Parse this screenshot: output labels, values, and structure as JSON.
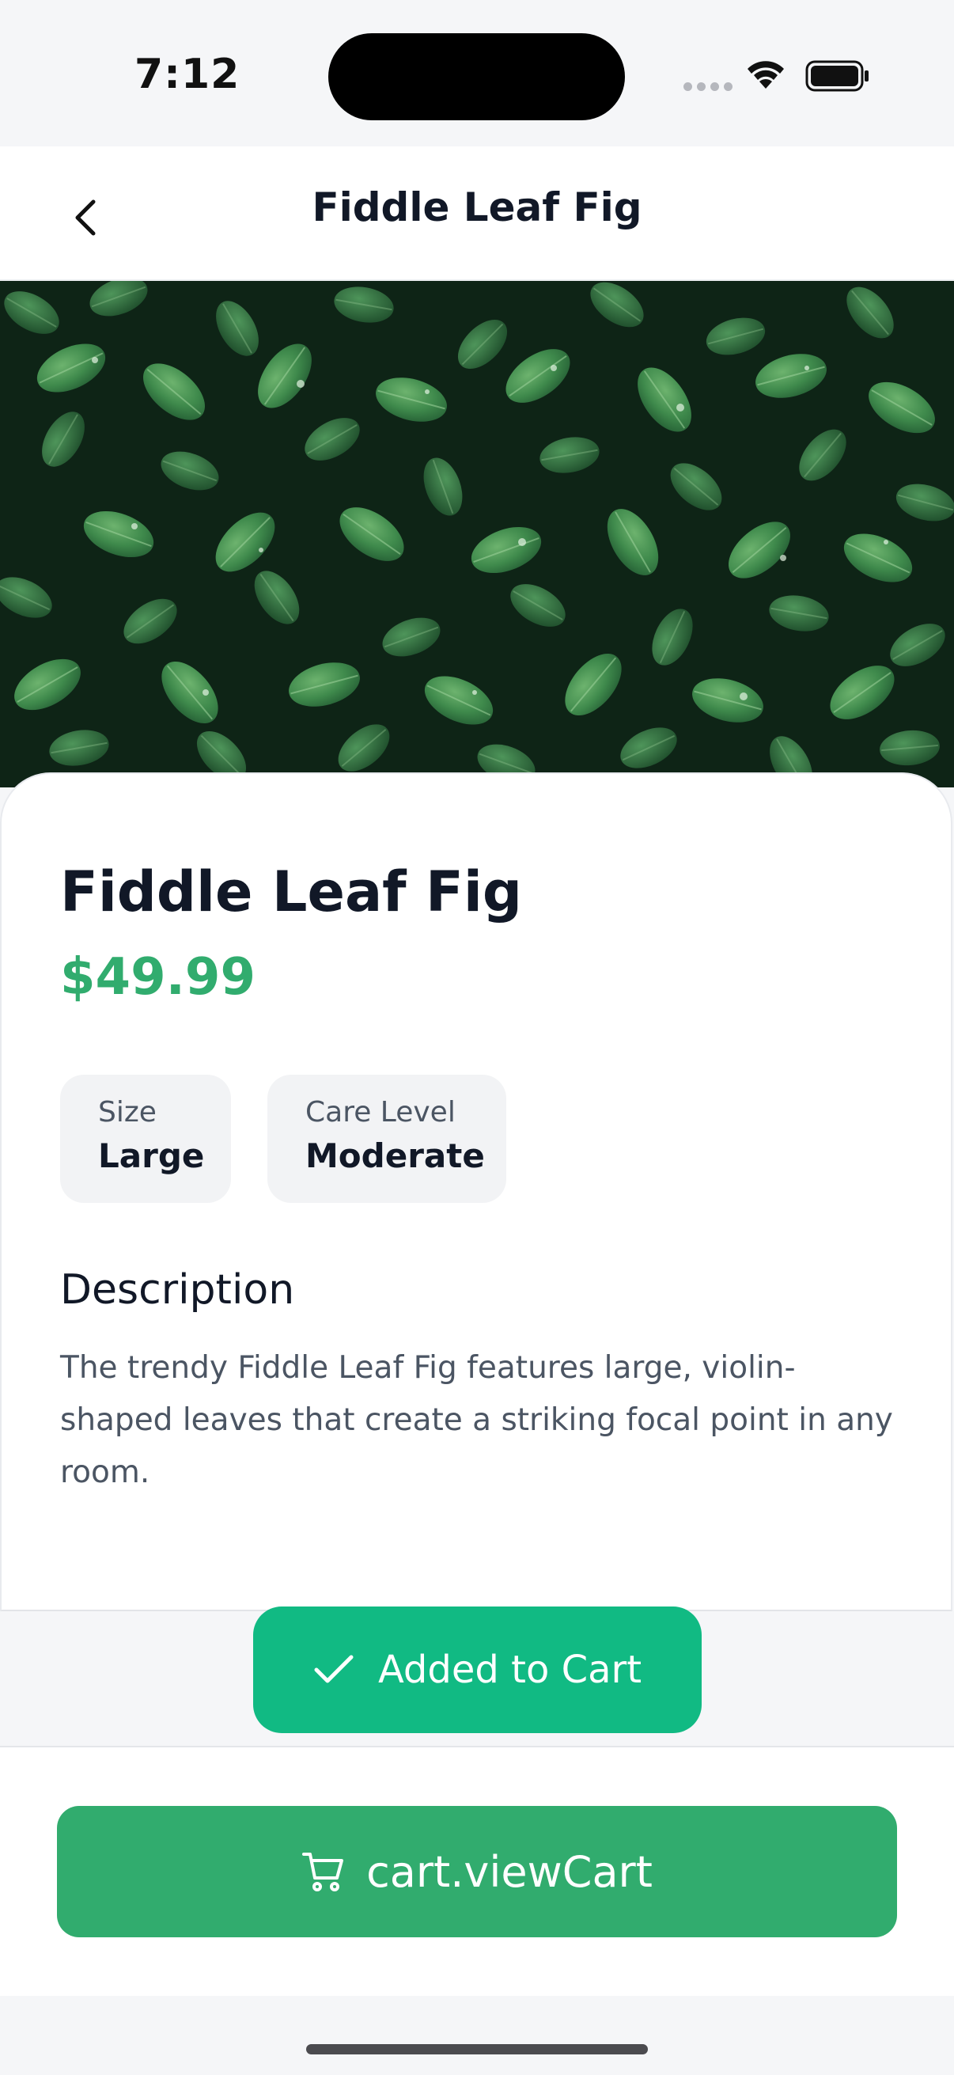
{
  "status_bar": {
    "time": "7:12"
  },
  "nav": {
    "title": "Fiddle Leaf Fig",
    "back_icon": "chevron-left-icon"
  },
  "product": {
    "name": "Fiddle Leaf Fig",
    "price": "$49.99",
    "attributes": [
      {
        "label": "Size",
        "value": "Large"
      },
      {
        "label": "Care Level",
        "value": "Moderate"
      }
    ],
    "description_heading": "Description",
    "description": "The trendy Fiddle Leaf Fig features large, violin-shaped leaves that create a striking focal point in any room."
  },
  "toast": {
    "icon": "checkmark-icon",
    "label": "Added to Cart"
  },
  "bottom": {
    "icon": "cart-icon",
    "view_cart_label": "cart.viewCart"
  },
  "colors": {
    "accent_green": "#31ac6e",
    "toast_green": "#11ba83"
  }
}
